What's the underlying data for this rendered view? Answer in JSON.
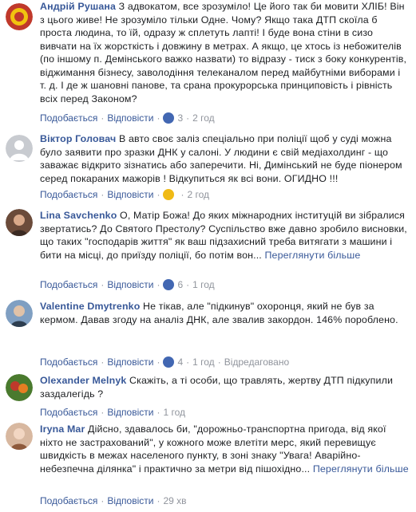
{
  "common": {
    "like": "Подобається",
    "reply": "Відповісти",
    "dot": "·",
    "see_more": "Переглянути більше"
  },
  "comments": [
    {
      "author": "Андрій Рушана",
      "text": "З адвокатом, все зрозуміло! Це його так би мовити ХЛІБ! Він з цього живе! Не зрозуміло тільки Одне. Чому? Якщо така ДТП скоїла б проста людина, то їй, одразу ж сплетуть лапті! І буде вона стіни в сизо вивчати на їх жорсткість і довжину в метрах. А якщо, це хтось із небожителів (по іншому п. Демінського важко назвати) то відразу - тиск з боку конкурентів, віджимання бізнесу, заволодіння телеканалом перед майбутніми виборами і т. д. І де ж шановні панове, та срана прокурорська принциповість і рівність всіх перед Законом?",
      "reaction": "like",
      "reaction_count": "3",
      "time": "2 год",
      "edited": "",
      "avatar_color": "#c0392b"
    },
    {
      "author": "Віктор Головач",
      "text": "В авто своє заліз спеціально при поліції щоб у суді можна було заявити про зразки ДНК у салоні. У людини є свій медіахолдинг - що заважає відкрито зізнатись або заперечити. Ні, Димінський не буде піонером серед покараних мажорів ! Відкупиться як всі вони. ОГИДНО !!!",
      "reaction": "angry",
      "reaction_count": "",
      "time": "2 год",
      "edited": "",
      "avatar_color": "#c8cbd0"
    },
    {
      "author": "Lina Savchenko",
      "text": "О, Матір Божа! До яких міжнародних інституцій ви зібралися звертатись? До Святого Престолу? Суспільство вже давно зробило висновки, що таких \"господарів життя\" як ваш підзахисний треба витягати з машини і бити на місці, до приїзду поліції, бо потім вон...",
      "see_more": true,
      "reaction": "like",
      "reaction_count": "6",
      "time": "1 год",
      "edited": "",
      "avatar_color": "#6b4b3a"
    },
    {
      "author": "Valentine Dmytrenko",
      "text": "Не тікав, але \"підкинув\" охоронця, який не був за кермом. Давав згоду на аналіз ДНК, але звалив закордон. 146% пороблено.",
      "reaction": "like",
      "reaction_count": "4",
      "time": "1 год",
      "edited": "Відредаговано",
      "avatar_color": "#7f9fc2"
    },
    {
      "author": "Olexander Melnyk",
      "text": "Скажіть, а ті особи, що травлять, жертву ДТП підкупили заздалегідь ?",
      "reaction": "",
      "reaction_count": "",
      "time": "1 год",
      "edited": "",
      "avatar_color": "#4a7a2e"
    },
    {
      "author": "Iryna Mar",
      "text": "Дійсно, здавалось би, \"дорожньо-транспортна пригода, від якої ніхто не застрахований\", у кожного може влетіти мерс, який перевищує швидкість в межах населеного пункту, в зоні знаку \"Увага! Аварійно-небезпечна ділянка\" і практично за метри від пішохідно...",
      "see_more": true,
      "reaction": "",
      "reaction_count": "",
      "time": "29 хв",
      "edited": "",
      "avatar_color": "#d8b8a0"
    }
  ]
}
